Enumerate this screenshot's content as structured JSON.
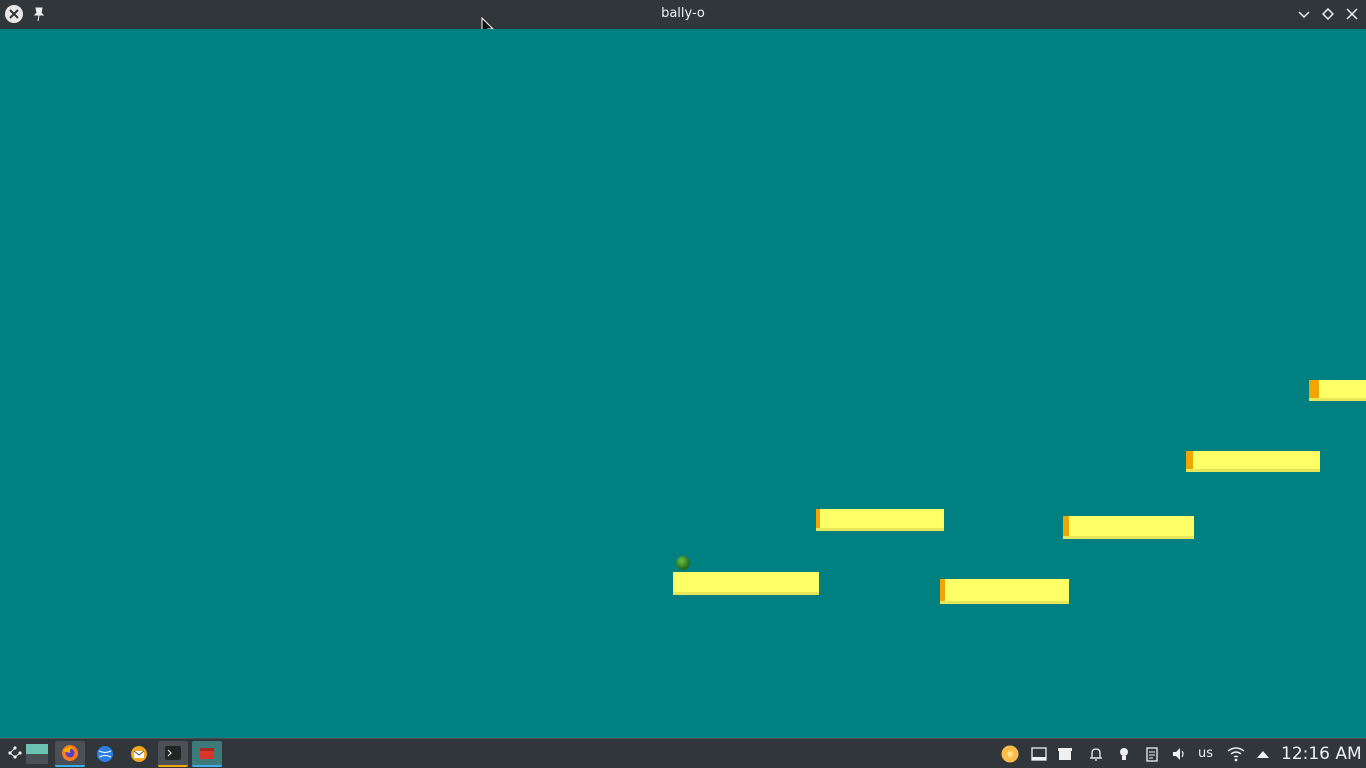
{
  "window": {
    "title": "bally-o",
    "app_icon": "app-logo-icon",
    "pin_icon": "pin-icon",
    "controls": [
      "minimize-icon",
      "maximize-icon",
      "close-icon"
    ]
  },
  "game": {
    "background_color": "#008080",
    "platform_color": "#ffff66",
    "platform_edge_color": "#f0a500",
    "ball_color": "#2f7a22"
  },
  "taskbar": {
    "launcher_icon": "application-launcher-icon",
    "tasks": [
      {
        "name": "desktop-pager-icon"
      },
      {
        "name": "firefox-icon"
      },
      {
        "name": "browser-globe-icon"
      },
      {
        "name": "thunderbird-icon"
      },
      {
        "name": "terminal-icon"
      },
      {
        "name": "game-window-icon"
      }
    ],
    "tray": {
      "icons": [
        "updates-icon",
        "display-icon",
        "files-icon",
        "alarm-icon",
        "light-icon",
        "clipboard-icon",
        "volume-icon"
      ],
      "keyboard_layout": "us",
      "network_icon": "wifi-icon",
      "expand_icon": "tray-expand-icon"
    },
    "clock": "12:16 AM"
  }
}
